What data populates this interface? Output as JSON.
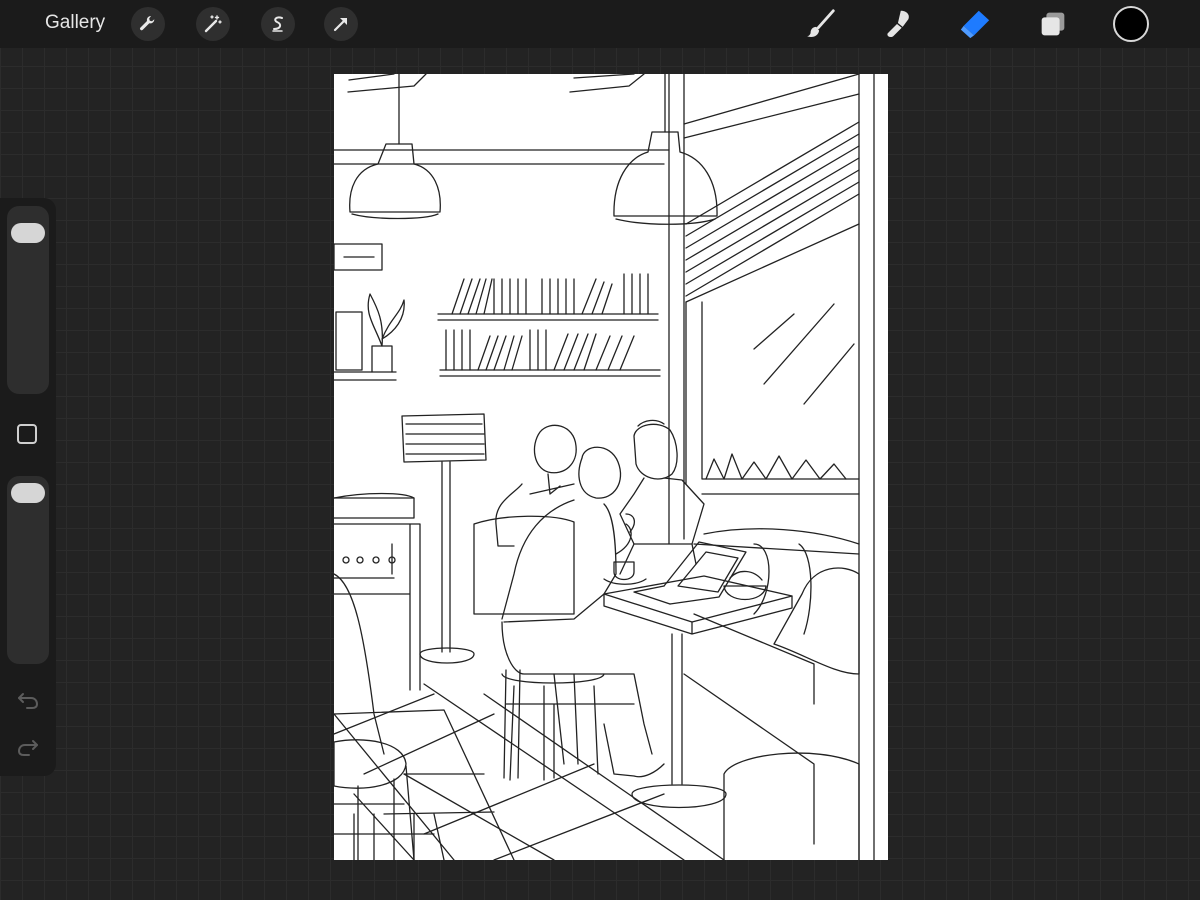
{
  "toolbar": {
    "gallery_label": "Gallery",
    "left_tools": [
      {
        "name": "actions",
        "icon": "wrench-icon"
      },
      {
        "name": "adjustments",
        "icon": "magic-wand-icon"
      },
      {
        "name": "selection",
        "icon": "selection-s-icon"
      },
      {
        "name": "transform",
        "icon": "arrow-cursor-icon"
      }
    ],
    "right_tools": [
      {
        "name": "brush",
        "icon": "brush-icon",
        "active": false
      },
      {
        "name": "smudge",
        "icon": "smudge-icon",
        "active": false
      },
      {
        "name": "eraser",
        "icon": "eraser-icon",
        "active": true
      },
      {
        "name": "layers",
        "icon": "layers-icon",
        "active": false
      }
    ],
    "current_color": "#000000",
    "active_color": "#1e7bff"
  },
  "sidebar": {
    "brush_size_level": 0.92,
    "opacity_level": 0.98,
    "buttons": [
      "undo-icon",
      "redo-icon",
      "modify-square-icon"
    ]
  },
  "canvas": {
    "artwork": "line-art-cafe-scene"
  }
}
